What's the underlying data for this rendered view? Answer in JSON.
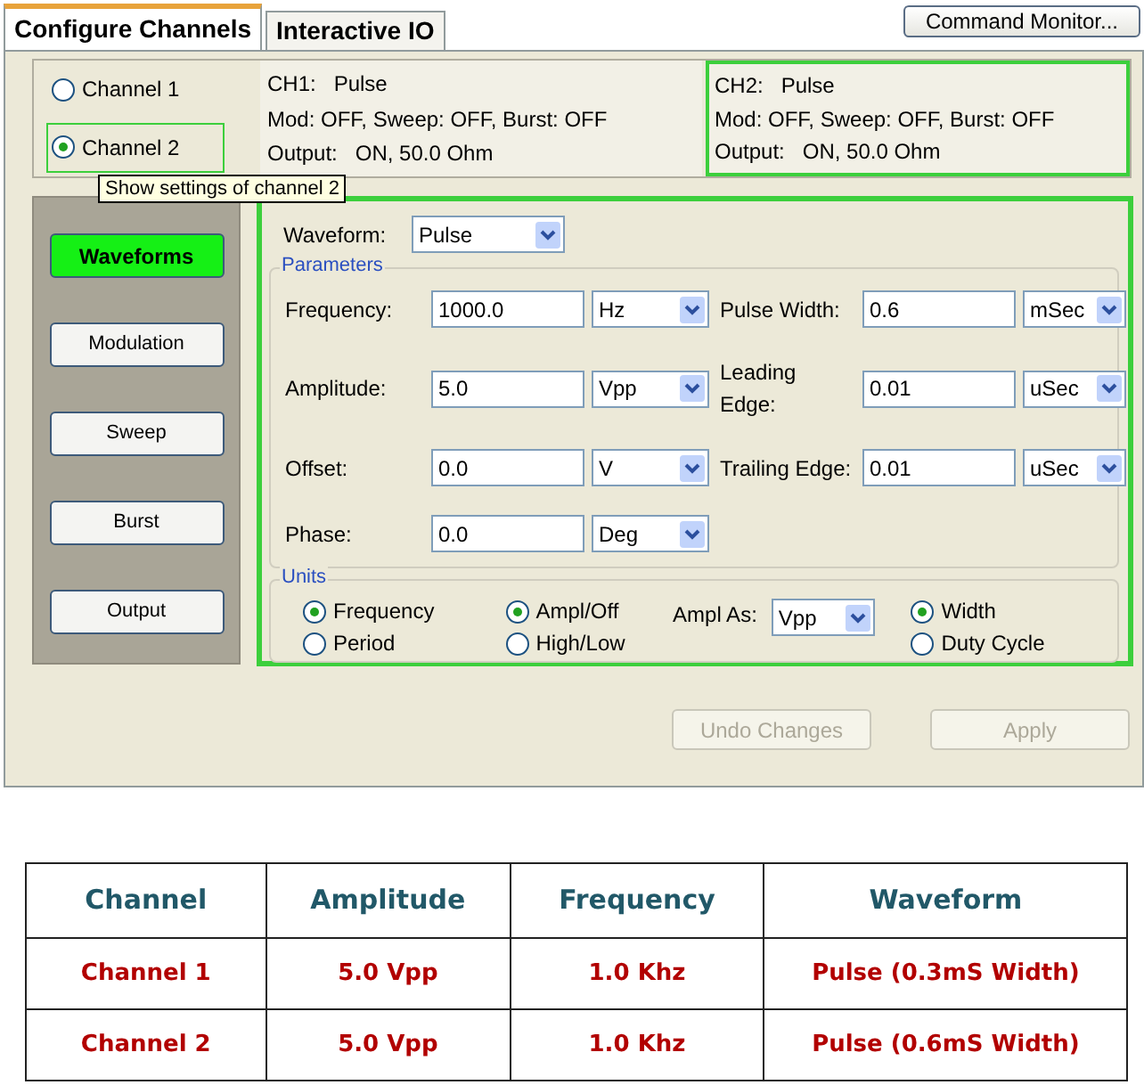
{
  "tabs": [
    {
      "label": "Configure Channels",
      "selected": true
    },
    {
      "label": "Interactive IO",
      "selected": false
    }
  ],
  "command_button": "Command Monitor...",
  "channels": [
    {
      "label": "Channel 1",
      "selected": false
    },
    {
      "label": "Channel 2",
      "selected": true
    }
  ],
  "tooltip": "Show settings of channel 2",
  "summaries": [
    {
      "lines": [
        "CH1:   Pulse",
        "Mod: OFF, Sweep: OFF, Burst: OFF",
        "Output:   ON, 50.0 Ohm"
      ],
      "selected": false
    },
    {
      "lines": [
        "CH2:   Pulse",
        "Mod: OFF, Sweep: OFF, Burst: OFF",
        "Output:   ON, 50.0 Ohm"
      ],
      "selected": true
    }
  ],
  "nav": [
    {
      "label": "Waveforms",
      "selected": true
    },
    {
      "label": "Modulation",
      "selected": false
    },
    {
      "label": "Sweep",
      "selected": false
    },
    {
      "label": "Burst",
      "selected": false
    },
    {
      "label": "Output",
      "selected": false
    }
  ],
  "waveform": {
    "label": "Waveform:",
    "value": "Pulse"
  },
  "parameters": {
    "title": "Parameters",
    "left": [
      {
        "label": "Frequency:",
        "value": "1000.0",
        "unit": "Hz"
      },
      {
        "label": "Amplitude:",
        "value": "5.0",
        "unit": "Vpp"
      },
      {
        "label": "Offset:",
        "value": "0.0",
        "unit": "V"
      },
      {
        "label": "Phase:",
        "value": "0.0",
        "unit": "Deg"
      }
    ],
    "right": [
      {
        "label": "Pulse Width:",
        "value": "0.6",
        "unit": "mSec"
      },
      {
        "label": "Leading Edge:",
        "value": "0.01",
        "unit": "uSec"
      },
      {
        "label": "Trailing Edge:",
        "value": "0.01",
        "unit": "uSec"
      }
    ]
  },
  "units": {
    "title": "Units",
    "groups": [
      [
        {
          "label": "Frequency",
          "selected": true
        },
        {
          "label": "Period",
          "selected": false
        }
      ],
      [
        {
          "label": "Ampl/Off",
          "selected": true
        },
        {
          "label": "High/Low",
          "selected": false
        }
      ],
      [
        {
          "label": "Width",
          "selected": true
        },
        {
          "label": "Duty Cycle",
          "selected": false
        }
      ]
    ],
    "ampl_as": {
      "label": "Ampl As:",
      "value": "Vpp"
    }
  },
  "actions": [
    {
      "label": "Undo Changes",
      "disabled": true
    },
    {
      "label": "Apply",
      "disabled": true
    }
  ],
  "table": {
    "columns": [
      "Channel",
      "Amplitude",
      "Frequency",
      "Waveform"
    ],
    "rows": [
      [
        "Channel 1",
        "5.0 Vpp",
        "1.0 Khz",
        "Pulse (0.3mS Width)"
      ],
      [
        "Channel 2",
        "5.0 Vpp",
        "1.0 Khz",
        "Pulse (0.6mS Width)"
      ]
    ]
  }
}
